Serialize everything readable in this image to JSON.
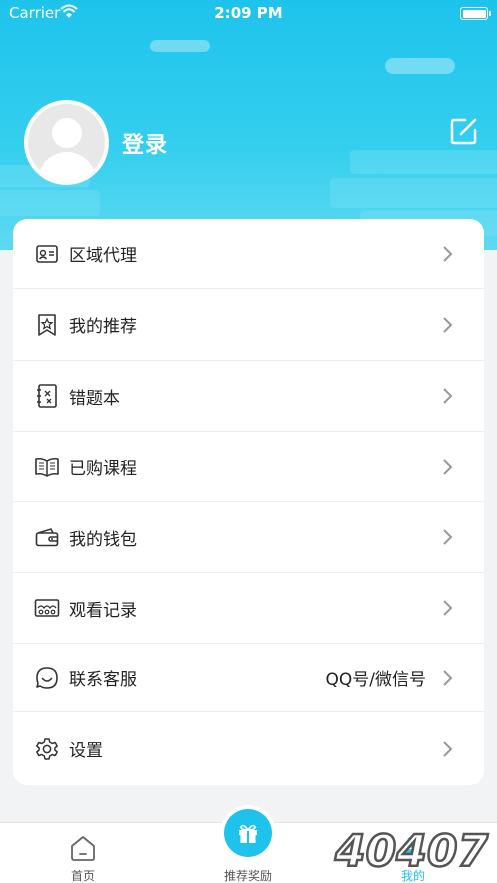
{
  "status_bar": {
    "carrier": "Carrier",
    "time": "2:09 PM"
  },
  "profile": {
    "login_label": "登录"
  },
  "menu": [
    {
      "label": "区域代理",
      "icon": "id-card-icon"
    },
    {
      "label": "我的推荐",
      "icon": "bookmark-star-icon"
    },
    {
      "label": "错题本",
      "icon": "notebook-icon"
    },
    {
      "label": "已购课程",
      "icon": "open-book-icon"
    },
    {
      "label": "我的钱包",
      "icon": "wallet-icon"
    },
    {
      "label": "观看记录",
      "icon": "history-icon"
    },
    {
      "label": "联系客服",
      "icon": "chat-icon",
      "value": "QQ号/微信号"
    },
    {
      "label": "设置",
      "icon": "gear-icon"
    }
  ],
  "tabbar": {
    "home": "首页",
    "reward": "推荐奖励",
    "mine": "我的"
  },
  "watermark": "40407",
  "colors": {
    "accent": "#1ec3ec"
  }
}
